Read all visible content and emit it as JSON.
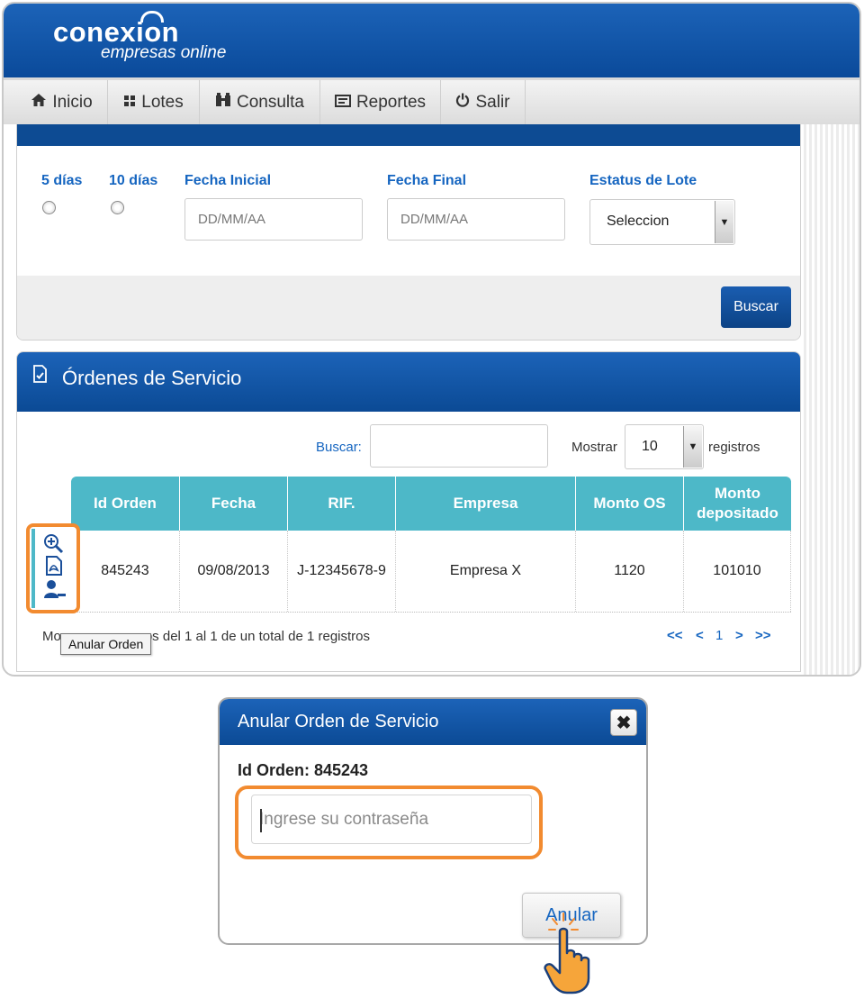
{
  "app": {
    "brand": "conexion",
    "tagline": "empresas online"
  },
  "nav": {
    "items": [
      {
        "label": "Inicio",
        "icon": "home-icon"
      },
      {
        "label": "Lotes",
        "icon": "lotes-icon"
      },
      {
        "label": "Consulta",
        "icon": "consulta-icon"
      },
      {
        "label": "Reportes",
        "icon": "reportes-icon"
      },
      {
        "label": "Salir",
        "icon": "power-icon"
      }
    ]
  },
  "filters": {
    "five_days": "5 días",
    "ten_days": "10 días",
    "start_date_label": "Fecha Inicial",
    "start_date_placeholder": "DD/MM/AA",
    "end_date_label": "Fecha Final",
    "end_date_placeholder": "DD/MM/AA",
    "status_label": "Estatus de Lote",
    "status_value": "Seleccion",
    "search_button": "Buscar"
  },
  "orders": {
    "title": "Órdenes de Servicio",
    "search_label": "Buscar:",
    "show_label": "Mostrar",
    "show_value": "10",
    "records_label": "registros",
    "columns": [
      "Id Orden",
      "Fecha",
      "RIF.",
      "Empresa",
      "Monto OS",
      "Monto depositado"
    ],
    "rows": [
      {
        "id": "845243",
        "date": "09/08/2013",
        "rif": "J-12345678-9",
        "company": "Empresa X",
        "amount_os": "1120",
        "amount_deposited": "101010"
      }
    ],
    "info_prefix": "Mo",
    "info_suffix": "os del 1 al 1 de un total de 1 registros",
    "tooltip": "Anular Orden",
    "pagination": {
      "first": "<<",
      "prev": "<",
      "page": "1",
      "next": ">",
      "last": ">>"
    }
  },
  "dialog": {
    "title": "Anular Orden de Servicio",
    "close": "✖",
    "order_label": "Id Orden: 845243",
    "password_placeholder": "Ingrese su contraseña",
    "submit": "Anular"
  },
  "colors": {
    "primary": "#0b4a95",
    "accent": "#4db8c8",
    "highlight": "#f28b30",
    "link": "#1565c0"
  }
}
